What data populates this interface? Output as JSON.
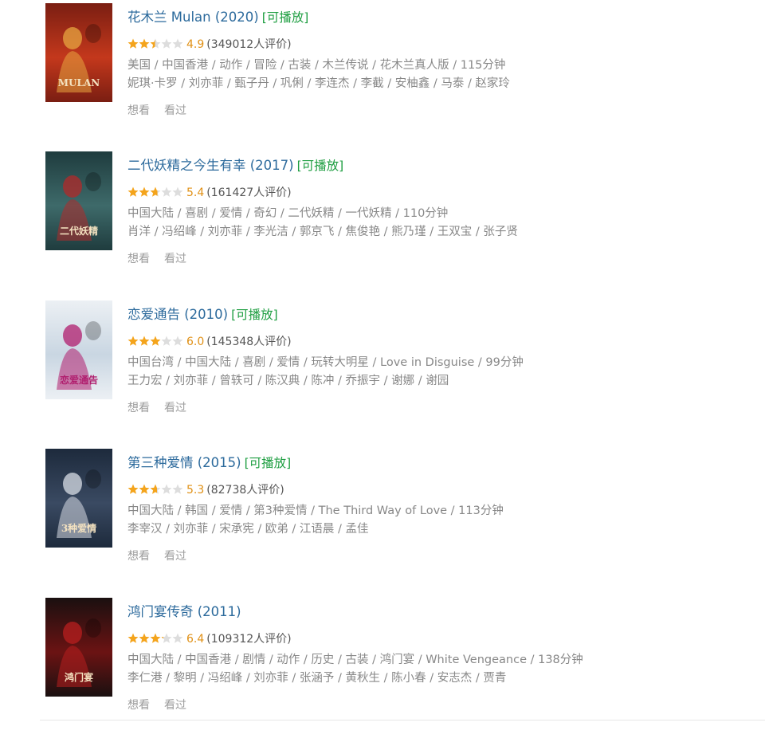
{
  "movies": [
    {
      "title": "花木兰 Mulan (2020)",
      "playable": "[可播放]",
      "rating": 4.9,
      "score": "4.9",
      "votes": "(349012人评价)",
      "meta": "美国 / 中国香港 / 动作 / 冒险 / 古装 / 木兰传说 / 花木兰真人版 / 115分钟",
      "cast": "妮琪·卡罗 / 刘亦菲 / 甄子丹 / 巩俐 / 李连杰 / 李截 / 安柚鑫 / 马泰 / 赵家玲",
      "poster_text": "MULAN",
      "colors": [
        "#7a1e12",
        "#c4381c",
        "#e7a640"
      ]
    },
    {
      "title": "二代妖精之今生有幸 (2017)",
      "playable": "[可播放]",
      "rating": 5.4,
      "score": "5.4",
      "votes": "(161427人评价)",
      "meta": "中国大陆 / 喜剧 / 爱情 / 奇幻 / 二代妖精 / 一代妖精 / 110分钟",
      "cast": "肖洋 / 冯绍峰 / 刘亦菲 / 李光洁 / 郭京飞 / 焦俊艳 / 熊乃瑾 / 王双宝 / 张子贤",
      "poster_text": "二代妖精",
      "colors": [
        "#1f3c3e",
        "#3e6a6a",
        "#b22a2a"
      ]
    },
    {
      "title": "恋爱通告 (2010)",
      "playable": "[可播放]",
      "rating": 6.0,
      "score": "6.0",
      "votes": "(145348人评价)",
      "meta": "中国台湾 / 中国大陆 / 喜剧 / 爱情 / 玩转大明星 / Love in Disguise / 99分钟",
      "cast": "王力宏 / 刘亦菲 / 曾轶可 / 陈汉典 / 陈冲 / 乔振宇 / 谢娜 / 谢园",
      "poster_text": "恋爱通告",
      "colors": [
        "#ecf0f4",
        "#c9d6e2",
        "#b01e6e"
      ]
    },
    {
      "title": "第三种爱情 (2015)",
      "playable": "[可播放]",
      "rating": 5.3,
      "score": "5.3",
      "votes": "(82738人评价)",
      "meta": "中国大陆 / 韩国 / 爱情 / 第3种爱情 / The Third Way of Love / 113分钟",
      "cast": "李宰汉 / 刘亦菲 / 宋承宪 / 欧弟 / 江语晨 / 孟佳",
      "poster_text": "3种爱情",
      "colors": [
        "#1d2a3c",
        "#3a4a62",
        "#d8dde6"
      ]
    },
    {
      "title": "鸿门宴传奇 (2011)",
      "playable": "",
      "rating": 6.4,
      "score": "6.4",
      "votes": "(109312人评价)",
      "meta": "中国大陆 / 中国香港 / 剧情 / 动作 / 历史 / 古装 / 鸿门宴 / White Vengeance / 138分钟",
      "cast": "李仁港 / 黎明 / 冯绍峰 / 刘亦菲 / 张涵予 / 黄秋生 / 陈小春 / 安志杰 / 贾青",
      "poster_text": "鸿门宴",
      "colors": [
        "#1a1010",
        "#6b1313",
        "#b81f1f"
      ]
    }
  ],
  "actions": {
    "want": "想看",
    "seen": "看过"
  },
  "theme": {
    "star_on": "#f4a41c",
    "star_off": "#dddddd"
  }
}
